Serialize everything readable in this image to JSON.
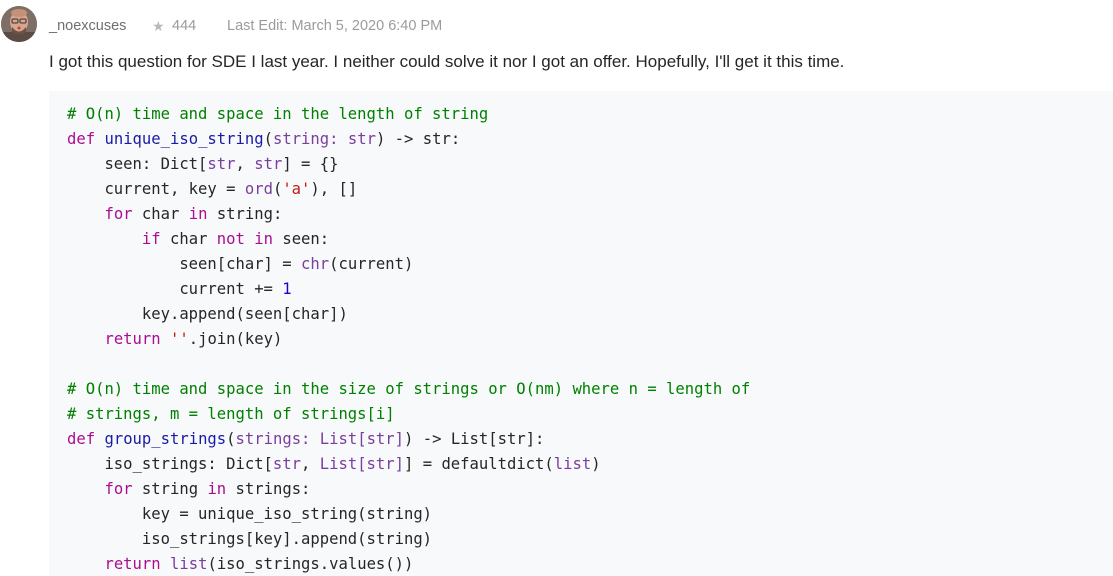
{
  "post": {
    "author": "_noexcuses",
    "star_icon": "star-icon",
    "reputation": "444",
    "last_edit": "Last Edit: March 5, 2020 6:40 PM",
    "text": "I got this question for SDE I last year. I neither could solve it nor I got an offer. Hopefully, I'll get it this time."
  },
  "code": {
    "language": "python",
    "lines": [
      [
        {
          "t": "comment",
          "s": "# O(n) time and space in the length of string"
        }
      ],
      [
        {
          "t": "keyword",
          "s": "def"
        },
        {
          "t": "plain",
          "s": " "
        },
        {
          "t": "func",
          "s": "unique_iso_string"
        },
        {
          "t": "plain",
          "s": "("
        },
        {
          "t": "type",
          "s": "string: str"
        },
        {
          "t": "plain",
          "s": ") -> str:"
        }
      ],
      [
        {
          "t": "plain",
          "s": "    seen: Dict["
        },
        {
          "t": "type",
          "s": "str"
        },
        {
          "t": "plain",
          "s": ", "
        },
        {
          "t": "type",
          "s": "str"
        },
        {
          "t": "plain",
          "s": "] = {}"
        }
      ],
      [
        {
          "t": "plain",
          "s": "    current, key = "
        },
        {
          "t": "builtin",
          "s": "ord"
        },
        {
          "t": "plain",
          "s": "("
        },
        {
          "t": "string",
          "s": "'a'"
        },
        {
          "t": "plain",
          "s": "), []"
        }
      ],
      [
        {
          "t": "plain",
          "s": "    "
        },
        {
          "t": "keyword",
          "s": "for"
        },
        {
          "t": "plain",
          "s": " char "
        },
        {
          "t": "keyword",
          "s": "in"
        },
        {
          "t": "plain",
          "s": " string:"
        }
      ],
      [
        {
          "t": "plain",
          "s": "        "
        },
        {
          "t": "keyword",
          "s": "if"
        },
        {
          "t": "plain",
          "s": " char "
        },
        {
          "t": "keyword",
          "s": "not in"
        },
        {
          "t": "plain",
          "s": " seen:"
        }
      ],
      [
        {
          "t": "plain",
          "s": "            seen[char] = "
        },
        {
          "t": "builtin",
          "s": "chr"
        },
        {
          "t": "plain",
          "s": "(current)"
        }
      ],
      [
        {
          "t": "plain",
          "s": "            current += "
        },
        {
          "t": "number",
          "s": "1"
        }
      ],
      [
        {
          "t": "plain",
          "s": "        key.append(seen[char])"
        }
      ],
      [
        {
          "t": "plain",
          "s": "    "
        },
        {
          "t": "keyword",
          "s": "return"
        },
        {
          "t": "plain",
          "s": " "
        },
        {
          "t": "string",
          "s": "''"
        },
        {
          "t": "plain",
          "s": ".join(key)"
        }
      ],
      [
        {
          "t": "plain",
          "s": ""
        }
      ],
      [
        {
          "t": "comment",
          "s": "# O(n) time and space in the size of strings or O(nm) where n = length of"
        }
      ],
      [
        {
          "t": "comment",
          "s": "# strings, m = length of strings[i]"
        }
      ],
      [
        {
          "t": "keyword",
          "s": "def"
        },
        {
          "t": "plain",
          "s": " "
        },
        {
          "t": "func",
          "s": "group_strings"
        },
        {
          "t": "plain",
          "s": "("
        },
        {
          "t": "type",
          "s": "strings: List[str]"
        },
        {
          "t": "plain",
          "s": ") -> List[str]:"
        }
      ],
      [
        {
          "t": "plain",
          "s": "    iso_strings: Dict["
        },
        {
          "t": "type",
          "s": "str"
        },
        {
          "t": "plain",
          "s": ", "
        },
        {
          "t": "type",
          "s": "List[str]"
        },
        {
          "t": "plain",
          "s": "] = defaultdict("
        },
        {
          "t": "builtin",
          "s": "list"
        },
        {
          "t": "plain",
          "s": ")"
        }
      ],
      [
        {
          "t": "plain",
          "s": "    "
        },
        {
          "t": "keyword",
          "s": "for"
        },
        {
          "t": "plain",
          "s": " string "
        },
        {
          "t": "keyword",
          "s": "in"
        },
        {
          "t": "plain",
          "s": " strings:"
        }
      ],
      [
        {
          "t": "plain",
          "s": "        key = unique_iso_string(string)"
        }
      ],
      [
        {
          "t": "plain",
          "s": "        iso_strings[key].append(string)"
        }
      ],
      [
        {
          "t": "plain",
          "s": "    "
        },
        {
          "t": "keyword",
          "s": "return"
        },
        {
          "t": "plain",
          "s": " "
        },
        {
          "t": "builtin",
          "s": "list"
        },
        {
          "t": "plain",
          "s": "(iso_strings.values())"
        }
      ]
    ]
  },
  "colors": {
    "comment": "#008000",
    "keyword": "#aa0d91",
    "func": "#1a1aa6",
    "type": "#7a3e9d",
    "string": "#c41a16",
    "number": "#1c00cf",
    "code_background": "#f7f9fa"
  }
}
